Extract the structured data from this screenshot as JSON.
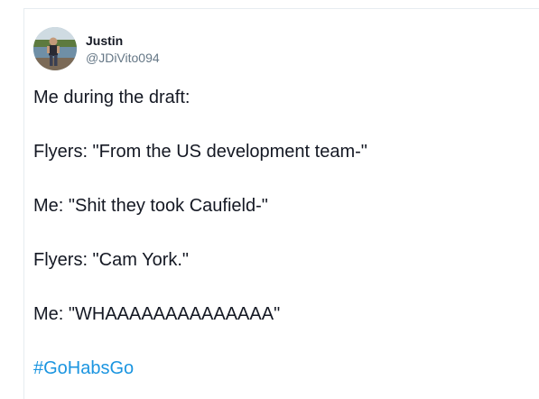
{
  "tweet": {
    "display_name": "Justin",
    "handle": "@JDiVito094",
    "lines": [
      "Me during the draft:",
      "Flyers: \"From the US development team-\"",
      "Me: \"Shit they took Caufield-\"",
      "Flyers: \"Cam York.\"",
      "Me: \"WHAAAAAAAAAAAAAA\""
    ],
    "hashtag": "#GoHabsGo"
  },
  "colors": {
    "text": "#141823",
    "secondary": "#657786",
    "link": "#1b95e0",
    "divider": "#e6ecf0"
  },
  "icons": {
    "avatar": "profile-photo-avatar"
  }
}
